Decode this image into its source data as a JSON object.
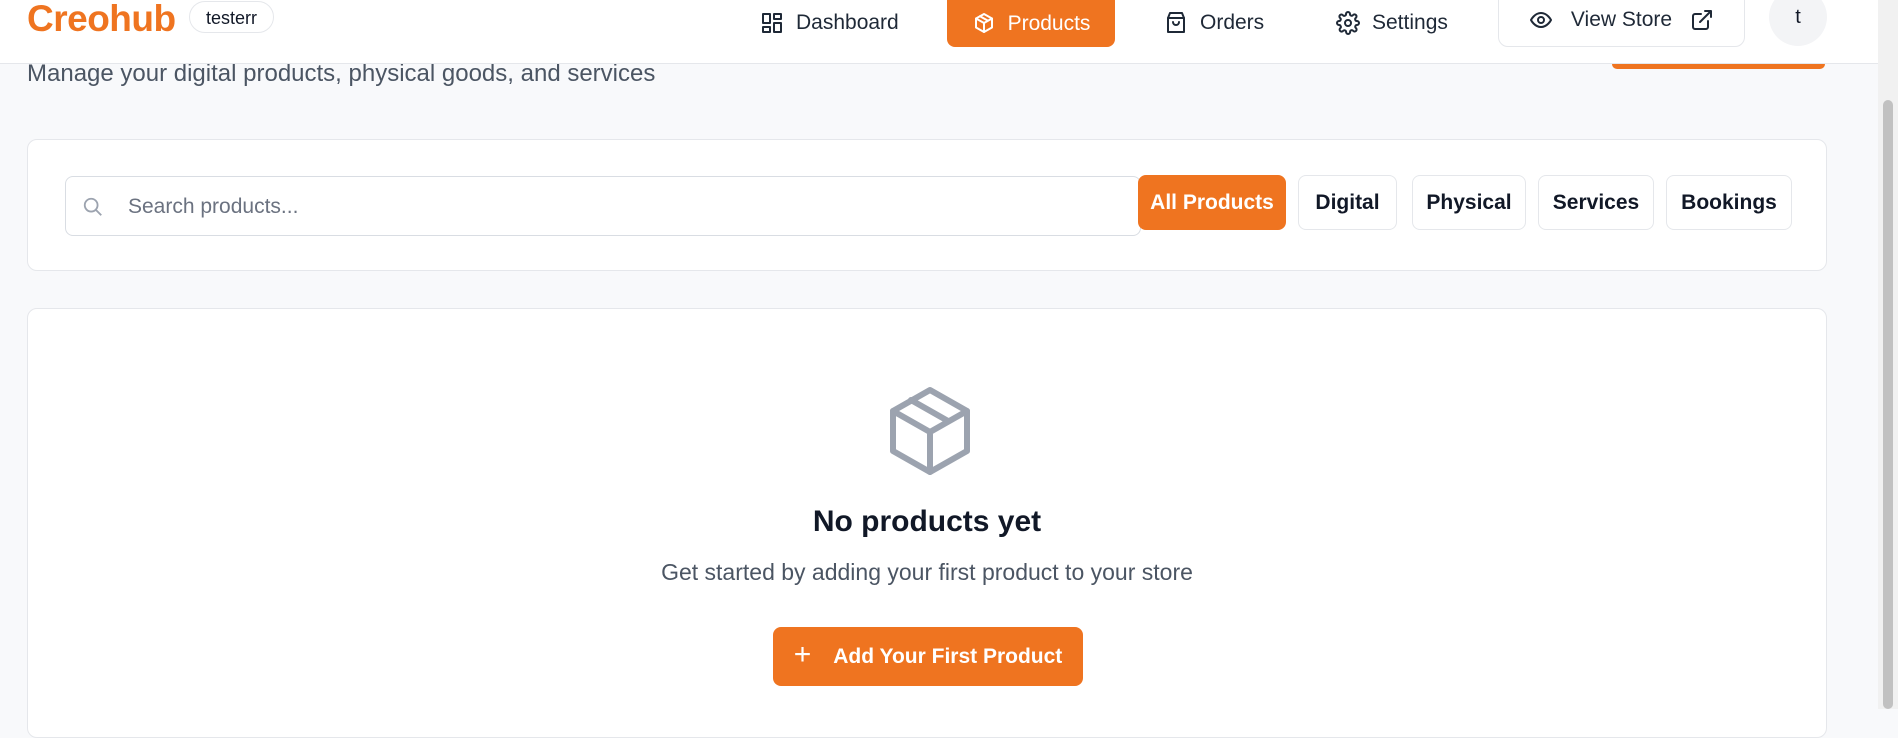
{
  "header": {
    "brand": "Creohub",
    "store_name": "testerr",
    "nav": [
      {
        "label": "Dashboard",
        "icon": "dashboard-icon"
      },
      {
        "label": "Products",
        "icon": "package-icon",
        "active": true
      },
      {
        "label": "Orders",
        "icon": "shopping-bag-icon"
      },
      {
        "label": "Settings",
        "icon": "gear-icon"
      }
    ],
    "view_store_label": "View Store",
    "avatar_initial": "t",
    "accent_color": "#ef7420"
  },
  "page": {
    "subtitle": "Manage your digital products, physical goods, and services"
  },
  "filters": {
    "search_placeholder": "Search products...",
    "search_value": "",
    "options": [
      {
        "label": "All Products",
        "active": true
      },
      {
        "label": "Digital",
        "active": false
      },
      {
        "label": "Physical",
        "active": false
      },
      {
        "label": "Services",
        "active": false
      },
      {
        "label": "Bookings",
        "active": false
      }
    ]
  },
  "empty_state": {
    "icon": "package-icon",
    "title": "No products yet",
    "description": "Get started by adding your first product to your store",
    "button_label": "Add Your First Product"
  }
}
